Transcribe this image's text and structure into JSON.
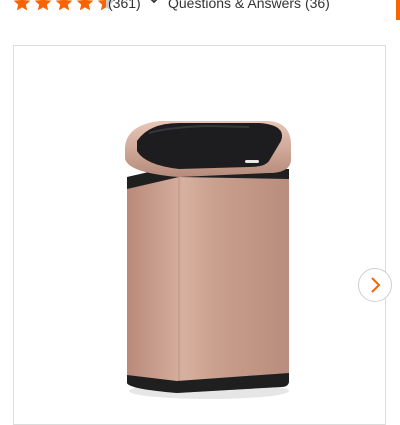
{
  "rating": {
    "stars": 4.5,
    "review_count_text": "(361)"
  },
  "qa": {
    "label": "Questions & Answers (36)"
  },
  "colors": {
    "star_fill": "#f96302",
    "star_empty": "#c9c9c9",
    "accent": "#f96302",
    "can_body": "#c99f8d",
    "lid": "#1d1d1f"
  },
  "icons": {
    "expand": "chevron-down-icon",
    "next": "chevron-right-icon"
  }
}
